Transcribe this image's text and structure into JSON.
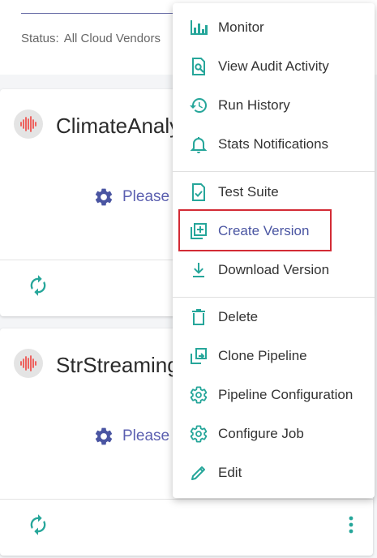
{
  "status": {
    "label": "Status:",
    "value": "All Cloud Vendors"
  },
  "cards": [
    {
      "title": "ClimateAnalysis",
      "message": "Please"
    },
    {
      "title": "StrStreaming",
      "message": "Please"
    }
  ],
  "menu": {
    "items": [
      {
        "label": "Monitor",
        "icon": "bar-chart-icon"
      },
      {
        "label": "View Audit Activity",
        "icon": "audit-search-icon"
      },
      {
        "label": "Run History",
        "icon": "history-icon"
      },
      {
        "label": "Stats Notifications",
        "icon": "bell-icon"
      },
      {
        "label": "Test Suite",
        "icon": "test-file-icon"
      },
      {
        "label": "Create Version",
        "icon": "add-box-icon",
        "highlighted": true
      },
      {
        "label": "Download Version",
        "icon": "download-icon"
      },
      {
        "label": "Delete",
        "icon": "trash-icon"
      },
      {
        "label": "Clone Pipeline",
        "icon": "clone-icon"
      },
      {
        "label": "Pipeline Configuration",
        "icon": "gear-icon"
      },
      {
        "label": "Configure Job",
        "icon": "gear-icon"
      },
      {
        "label": "Edit",
        "icon": "pencil-icon"
      }
    ]
  },
  "colors": {
    "icon_teal": "#26a69a",
    "accent_indigo": "#5b5fb0",
    "highlight_red": "#d32b35",
    "avatar_red": "#ef5350"
  }
}
